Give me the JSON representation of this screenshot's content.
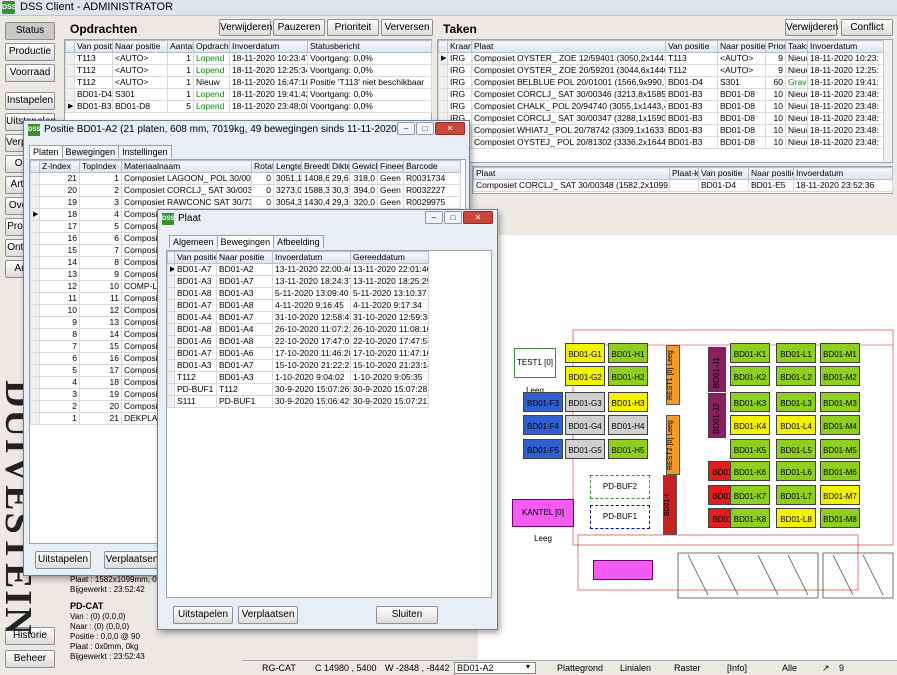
{
  "app": {
    "title": "DSS Client - ADMINISTRATOR"
  },
  "sidebar": {
    "items": [
      "Status",
      "Productie",
      "Voorraad",
      "Instapelen",
      "Uitstapelen",
      "Verplaatsen",
      "Orders",
      "Artikelen",
      "Overzicht",
      "Producten",
      "Ontvangst",
      "Archief",
      "Historie",
      "Beheer"
    ]
  },
  "orders": {
    "title": "Opdrachten",
    "buttons": [
      "Verwijderen",
      "Pauzeren",
      "Prioriteit",
      "Verversen"
    ],
    "columns": [
      "Van positie",
      "Naar positie",
      "Aantal",
      "Opdracht",
      "Invoerdatum",
      "Statusbericht"
    ],
    "rows": [
      [
        "T113",
        "<AUTO>",
        "1",
        "Lopend",
        "18-11-2020 10:23:47",
        "Voortgang: 0,0%"
      ],
      [
        "T112",
        "<AUTO>",
        "1",
        "Lopend",
        "18-11-2020 12:25:34",
        "Voortgang: 0,0%"
      ],
      [
        "T112",
        "<AUTO>",
        "1",
        "Nieuw",
        "18-11-2020 16:47:10",
        "Positie 'T113' niet beschikbaar"
      ],
      [
        "BD01-D4",
        "S301",
        "1",
        "Lopend",
        "18-11-2020 19:41:42",
        "Voortgang: 0,0%"
      ],
      [
        "BD01-B3",
        "BD01-D8",
        "5",
        "Lopend",
        "18-11-2020 23:48:08",
        "Voortgang: 0,0%"
      ]
    ]
  },
  "tasks": {
    "title": "Taken",
    "buttons": [
      "Verwijderen",
      "Conflict"
    ],
    "columns": [
      "Kraan",
      "Plaat",
      "Van positie",
      "Naar positie",
      "Priorit",
      "Taakst",
      "Invoerdatum"
    ],
    "rows": [
      [
        "IRG",
        "Composiet OYSTER_ ZOE 12/59401 (3050,2x1441,4)",
        "T113",
        "<AUTO>",
        "9",
        "Nieuw",
        "18-11-2020 10:23:"
      ],
      [
        "IRG",
        "Composiet OYSTER_ ZOE 20/59201 (3044,6x1440,1)",
        "T112",
        "<AUTO>",
        "9",
        "Nieuw",
        "18-11-2020 12:25:"
      ],
      [
        "IRG",
        "Composiet BELBLUE POL 20/01001 (1566,9x990,7)",
        "BD01-D4",
        "S301",
        "60",
        "Graver",
        "18-11-2020 19:41:"
      ],
      [
        "IRG",
        "Composiet CORCLJ_ SAT 30/00346 (3213,8x1585,9)",
        "BD01-B3",
        "BD01-D8",
        "10",
        "Nieuw",
        "18-11-2020 23:48:"
      ],
      [
        "IRG",
        "Composiet CHALK_ POL 20/94740 (3055,1x1443,4)",
        "BD01-B3",
        "BD01-D8",
        "10",
        "Nieuw",
        "18-11-2020 23:48:"
      ],
      [
        "IRG",
        "Composiet CORCLJ_ SAT 30/00347 (3288,1x1590,2)",
        "BD01-B3",
        "BD01-D8",
        "10",
        "Nieuw",
        "18-11-2020 23:48:"
      ],
      [
        "IRG",
        "Composiet WHIATJ_ POL 20/78742 (3309,1x1633,4)",
        "BD01-B3",
        "BD01-D8",
        "10",
        "Nieuw",
        "18-11-2020 23:48:"
      ],
      [
        "IRG",
        "Composiet OYSTEJ_ POL 20/81302 (3336,2x1644,4)",
        "BD01-B3",
        "BD01-D8",
        "10",
        "Nieuw",
        "18-11-2020 23:48:"
      ]
    ],
    "sub_columns": [
      "Plaat",
      "Plaat-k",
      "Van positie",
      "Naar positie",
      "Invoerdatum"
    ],
    "sub_rows": [
      [
        "Composiet CORCLJ_ SAT 30/00348 (1582,2x1099,3)",
        "",
        "BD01-D4",
        "BD01-E5",
        "18-11-2020 23:52:36"
      ]
    ]
  },
  "position_win": {
    "title": "Positie BD01-A2 (21 platen, 608 mm, 7019kg, 49 bewegingen sinds 11-11-2020)",
    "tabs": [
      "Platen",
      "Bewegingen",
      "Instellingen"
    ],
    "columns": [
      "Z-Index",
      "TopIndex",
      "Materiaalnaam",
      "Rotat",
      "Lengte",
      "Breedte",
      "Dikte",
      "Gewicht",
      "Fineer",
      "Barcode"
    ],
    "rows": [
      [
        "21",
        "1",
        "Composiet LAGOON_ POL 30/00209",
        "0",
        "3051,1",
        "1408,6",
        "29,6",
        "318,0",
        "Geen",
        "R0031734"
      ],
      [
        "20",
        "2",
        "Composiet CORCLJ_ SAT 30/00348",
        "0",
        "3273,0",
        "1588,3",
        "30,3",
        "394,0",
        "Geen",
        "R0032227"
      ],
      [
        "19",
        "3",
        "Composiet RAWCONC SAT 30/73200",
        "0",
        "3054,3",
        "1430,4",
        "29,3",
        "320,0",
        "Geen",
        "R0029975"
      ],
      [
        "18",
        "4",
        "Composiet",
        "",
        "",
        "",
        "",
        "",
        "",
        ""
      ],
      [
        "17",
        "5",
        "Composiet",
        "",
        "",
        "",
        "",
        "",
        "",
        ""
      ],
      [
        "16",
        "6",
        "Composiet",
        "",
        "",
        "",
        "",
        "",
        "",
        ""
      ],
      [
        "15",
        "7",
        "Composiet",
        "",
        "",
        "",
        "",
        "",
        "",
        ""
      ],
      [
        "14",
        "8",
        "Composiet",
        "",
        "",
        "",
        "",
        "",
        "",
        ""
      ],
      [
        "13",
        "9",
        "Composiet",
        "",
        "",
        "",
        "",
        "",
        "",
        ""
      ],
      [
        "12",
        "10",
        "COMP-LONG",
        "",
        "",
        "",
        "",
        "",
        "",
        ""
      ],
      [
        "11",
        "11",
        "Composiet",
        "",
        "",
        "",
        "",
        "",
        "",
        ""
      ],
      [
        "10",
        "12",
        "Composiet",
        "",
        "",
        "",
        "",
        "",
        "",
        ""
      ],
      [
        "9",
        "13",
        "Composiet",
        "",
        "",
        "",
        "",
        "",
        "",
        ""
      ],
      [
        "8",
        "14",
        "Composiet",
        "",
        "",
        "",
        "",
        "",
        "",
        ""
      ],
      [
        "7",
        "15",
        "Composiet",
        "",
        "",
        "",
        "",
        "",
        "",
        ""
      ],
      [
        "6",
        "16",
        "Composiet",
        "",
        "",
        "",
        "",
        "",
        "",
        ""
      ],
      [
        "5",
        "17",
        "Composiet",
        "",
        "",
        "",
        "",
        "",
        "",
        ""
      ],
      [
        "4",
        "18",
        "Composiet",
        "",
        "",
        "",
        "",
        "",
        "",
        ""
      ],
      [
        "3",
        "19",
        "Composiet",
        "",
        "",
        "",
        "",
        "",
        "",
        ""
      ],
      [
        "2",
        "20",
        "Composiet",
        "",
        "",
        "",
        "",
        "",
        "",
        ""
      ],
      [
        "1",
        "21",
        "DEKPLAAT",
        "",
        "",
        "",
        "",
        "",
        "",
        ""
      ]
    ],
    "buttons": [
      "Uitstapelen",
      "Verplaatsen"
    ]
  },
  "plate_win": {
    "title": "Plaat",
    "tabs": [
      "Algemeen",
      "Bewegingen",
      "Afbeelding"
    ],
    "columns": [
      "Van positie",
      "Naar positie",
      "Invoerdatum",
      "Gereeddatum"
    ],
    "rows": [
      [
        "BD01-A7",
        "BD01-A2",
        "13-11-2020 22:00:46",
        "13-11-2020 22:01:46"
      ],
      [
        "BD01-A3",
        "BD01-A7",
        "13-11-2020 18:24:37",
        "13-11-2020 18:25:29"
      ],
      [
        "BD01-A8",
        "BD01-A3",
        "5-11-2020 13:09:40",
        "5-11-2020 13:10:37"
      ],
      [
        "BD01-A7",
        "BD01-A8",
        "4-11-2020 9:16:45",
        "4-11-2020 9:17:34"
      ],
      [
        "BD01-A4",
        "BD01-A7",
        "31-10-2020 12:58:45",
        "31-10-2020 12:59:38"
      ],
      [
        "BD01-A8",
        "BD01-A4",
        "26-10-2020 11:07:21",
        "26-10-2020 11:08:16"
      ],
      [
        "BD01-A6",
        "BD01-A8",
        "22-10-2020 17:47:01",
        "22-10-2020 17:47:55"
      ],
      [
        "BD01-A7",
        "BD01-A6",
        "17-10-2020 11:46:28",
        "17-10-2020 11:47:16"
      ],
      [
        "BD01-A3",
        "BD01-A7",
        "15-10-2020 21:22:23",
        "15-10-2020 21:23:14"
      ],
      [
        "T112",
        "BD01-A3",
        "1-10-2020 9:04:02",
        "1-10-2020 9:05:35"
      ],
      [
        "PD-BUF1",
        "T112",
        "30-9-2020 15:07:26",
        "30-9-2020 15:07:28"
      ],
      [
        "S111",
        "PD-BUF1",
        "30-9-2020 15:06:42",
        "30-9-2020 15:07:21"
      ]
    ],
    "buttons": [
      "Uitstapelen",
      "Verplaatsen",
      "Sluiten"
    ]
  },
  "info": {
    "l1": "Plaat : 1582x1099mm, 0kg",
    "l2": "Bijgewerkt : 23:52:42",
    "cat": "PD-CAT",
    "l3": "Van : (0) (0,0,0)",
    "l4": "Naar : (0) (0,0,0)",
    "l5": "Positie : 0,0,0 @ 90",
    "l6": "Plaat : 0x0mm, 0kg",
    "l7": "Bijgewerkt : 23:52:43"
  },
  "brand": "DUIVESTEIN",
  "map": {
    "labels": [
      "BD01-G1",
      "BD01-H1",
      "BD01-J1",
      "BD01-K1",
      "BD01-L1",
      "BD01-M1",
      "BD01-G2",
      "BD01-H2",
      "BD01-K2",
      "BD01-L2",
      "BD01-M2",
      "BD01-F3",
      "BD01-G3",
      "BD01-H3",
      "BD01-J2",
      "BD01-K3",
      "BD01-L3",
      "BD01-M3",
      "BD01-F4",
      "BD01-G4",
      "BD01-H4",
      "BD01-K4",
      "BD01-L4",
      "BD01-M4",
      "BD01-F5",
      "BD01-G5",
      "BD01-H5",
      "BD01-K5",
      "BD01-L5",
      "BD01-M5",
      "BD01-J6",
      "BD01-K6",
      "BD01-L6",
      "BD01-M6",
      "BD01-J7",
      "BD01-K7",
      "BD01-L7",
      "BD01-M7",
      "BD01-J8",
      "BD01-K8",
      "BD01-L8",
      "BD01-M8"
    ],
    "texts": {
      "test": "TEST1 [0] Leeg",
      "kantel": "KANTEL [0] Leeg",
      "buf2": "PD-BUF2",
      "buf1": "PD-BUF1",
      "rest1": "REST1 [0] Leeg",
      "rest2": "REST2 [0] Leeg",
      "bd": "BD01-I"
    }
  },
  "statusbar": {
    "crane": "RG-CAT",
    "coord": "C 14980 , 5400",
    "w": "W -2848 , -8442",
    "pos": "BD01-A2",
    "plat": "Plattegrond",
    "lin": "Linialen",
    "rast": "Raster",
    "info": "[Info]",
    "alle": "Alle",
    "num": "9"
  }
}
